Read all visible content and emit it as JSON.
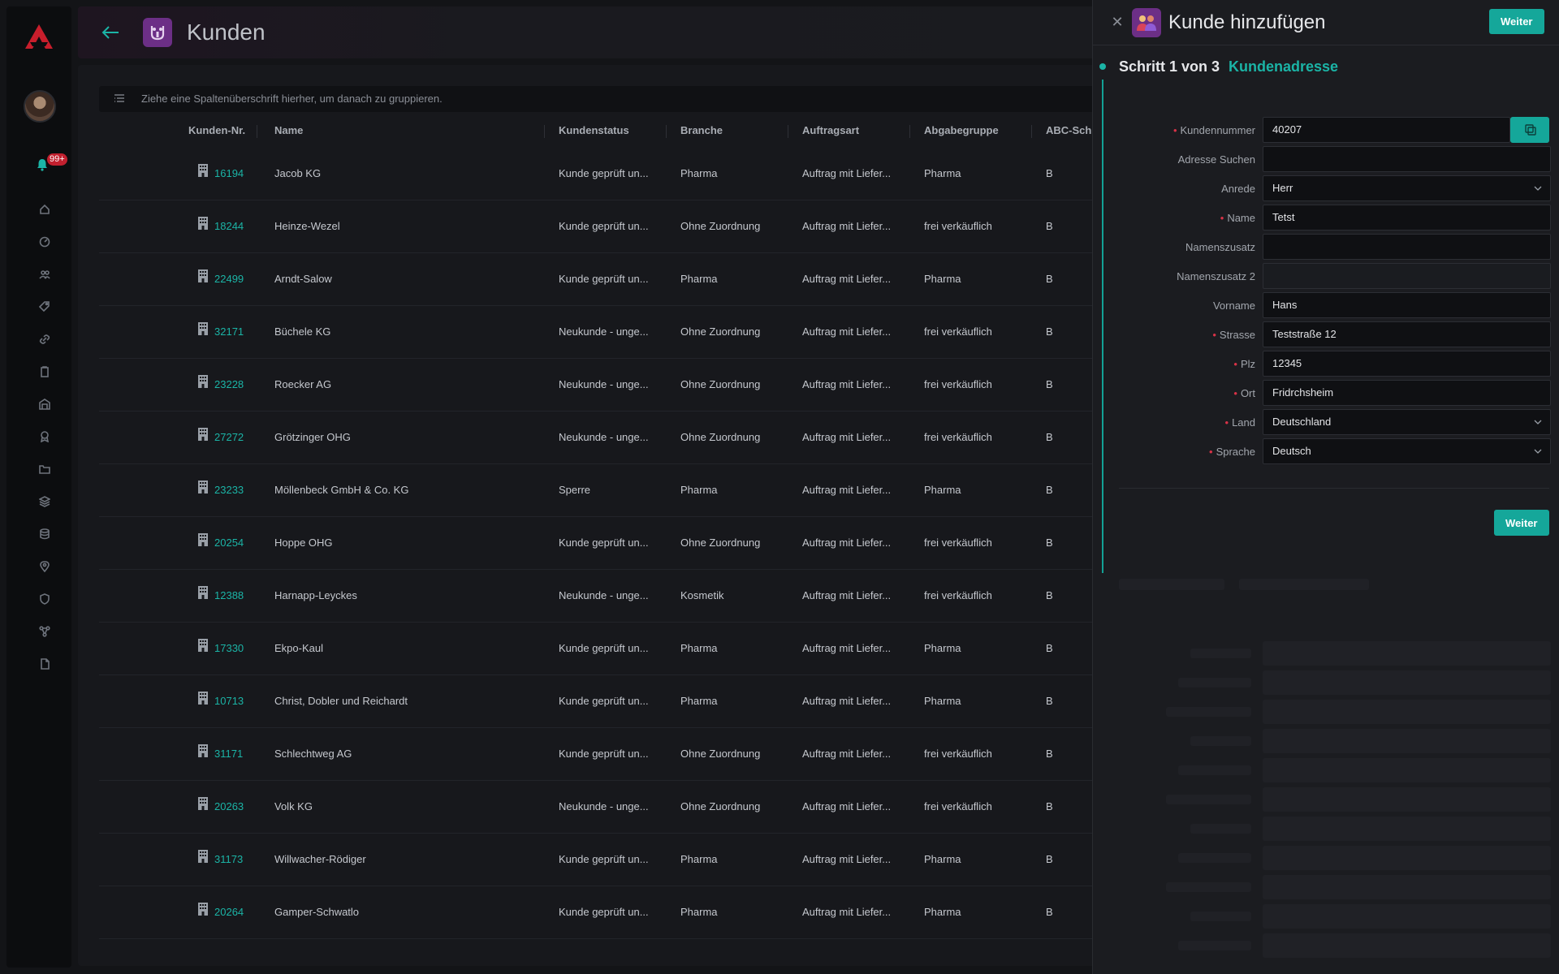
{
  "sidebar": {
    "notifications_count": "99+",
    "nav_icons": [
      "home-icon",
      "dashboard-icon",
      "users-icon",
      "tag-icon",
      "link-icon",
      "clipboard-icon",
      "warehouse-icon",
      "badge-icon",
      "folder-icon",
      "layers-icon",
      "database-icon",
      "location-icon",
      "shield-icon",
      "network-icon",
      "document-icon"
    ]
  },
  "header": {
    "title": "Kunden"
  },
  "table": {
    "group_hint": "Ziehe eine Spaltenüberschrift hierher, um danach zu gruppieren.",
    "columns": [
      "Kunden-Nr.",
      "Name",
      "Kundenstatus",
      "Branche",
      "Auftragsart",
      "Abgabegruppe",
      "ABC-Schl"
    ],
    "rows": [
      {
        "nr": "16194",
        "name": "Jacob KG",
        "status": "Kunde geprüft un...",
        "branche": "Pharma",
        "auftragsart": "Auftrag mit Liefer...",
        "abgabe": "Pharma",
        "abc": "B"
      },
      {
        "nr": "18244",
        "name": "Heinze-Wezel",
        "status": "Kunde geprüft un...",
        "branche": "Ohne Zuordnung",
        "auftragsart": "Auftrag mit Liefer...",
        "abgabe": "frei verkäuflich",
        "abc": "B"
      },
      {
        "nr": "22499",
        "name": "Arndt-Salow",
        "status": "Kunde geprüft un...",
        "branche": "Pharma",
        "auftragsart": "Auftrag mit Liefer...",
        "abgabe": "Pharma",
        "abc": "B"
      },
      {
        "nr": "32171",
        "name": "Büchele KG",
        "status": "Neukunde - unge...",
        "branche": "Ohne Zuordnung",
        "auftragsart": "Auftrag mit Liefer...",
        "abgabe": "frei verkäuflich",
        "abc": "B"
      },
      {
        "nr": "23228",
        "name": "Roecker AG",
        "status": "Neukunde - unge...",
        "branche": "Ohne Zuordnung",
        "auftragsart": "Auftrag mit Liefer...",
        "abgabe": "frei verkäuflich",
        "abc": "B"
      },
      {
        "nr": "27272",
        "name": "Grötzinger OHG",
        "status": "Neukunde - unge...",
        "branche": "Ohne Zuordnung",
        "auftragsart": "Auftrag mit Liefer...",
        "abgabe": "frei verkäuflich",
        "abc": "B"
      },
      {
        "nr": "23233",
        "name": "Möllenbeck GmbH & Co. KG",
        "status": "Sperre",
        "branche": "Pharma",
        "auftragsart": "Auftrag mit Liefer...",
        "abgabe": "Pharma",
        "abc": "B"
      },
      {
        "nr": "20254",
        "name": "Hoppe OHG",
        "status": "Kunde geprüft un...",
        "branche": "Ohne Zuordnung",
        "auftragsart": "Auftrag mit Liefer...",
        "abgabe": "frei verkäuflich",
        "abc": "B"
      },
      {
        "nr": "12388",
        "name": "Harnapp-Leyckes",
        "status": "Neukunde - unge...",
        "branche": "Kosmetik",
        "auftragsart": "Auftrag mit Liefer...",
        "abgabe": "frei verkäuflich",
        "abc": "B"
      },
      {
        "nr": "17330",
        "name": "Ekpo-Kaul",
        "status": "Kunde geprüft un...",
        "branche": "Pharma",
        "auftragsart": "Auftrag mit Liefer...",
        "abgabe": "Pharma",
        "abc": "B"
      },
      {
        "nr": "10713",
        "name": "Christ, Dobler und Reichardt",
        "status": "Kunde geprüft un...",
        "branche": "Pharma",
        "auftragsart": "Auftrag mit Liefer...",
        "abgabe": "Pharma",
        "abc": "B"
      },
      {
        "nr": "31171",
        "name": "Schlechtweg AG",
        "status": "Kunde geprüft un...",
        "branche": "Ohne Zuordnung",
        "auftragsart": "Auftrag mit Liefer...",
        "abgabe": "frei verkäuflich",
        "abc": "B"
      },
      {
        "nr": "20263",
        "name": "Volk KG",
        "status": "Neukunde - unge...",
        "branche": "Ohne Zuordnung",
        "auftragsart": "Auftrag mit Liefer...",
        "abgabe": "frei verkäuflich",
        "abc": "B"
      },
      {
        "nr": "31173",
        "name": "Willwacher-Rödiger",
        "status": "Kunde geprüft un...",
        "branche": "Pharma",
        "auftragsart": "Auftrag mit Liefer...",
        "abgabe": "Pharma",
        "abc": "B"
      },
      {
        "nr": "20264",
        "name": "Gamper-Schwatlo",
        "status": "Kunde geprüft un...",
        "branche": "Pharma",
        "auftragsart": "Auftrag mit Liefer...",
        "abgabe": "Pharma",
        "abc": "B"
      }
    ]
  },
  "drawer": {
    "title": "Kunde hinzufügen",
    "next_label": "Weiter",
    "step_title": "Schritt 1 von 3",
    "step_subtitle": "Kundenadresse",
    "fields": [
      {
        "label": "Kundennummer",
        "required": true,
        "value": "40207",
        "type": "text"
      },
      {
        "label": "Adresse Suchen",
        "required": false,
        "value": "",
        "type": "text"
      },
      {
        "label": "Anrede",
        "required": false,
        "value": "Herr",
        "type": "select"
      },
      {
        "label": "Name",
        "required": true,
        "value": "Tetst",
        "type": "text"
      },
      {
        "label": "Namenszusatz",
        "required": false,
        "value": "",
        "type": "text"
      },
      {
        "label": "Namenszusatz 2",
        "required": false,
        "value": "",
        "type": "text"
      },
      {
        "label": "Vorname",
        "required": false,
        "value": "Hans",
        "type": "text"
      },
      {
        "label": "Strasse",
        "required": true,
        "value": "Teststraße 12",
        "type": "text"
      },
      {
        "label": "Plz",
        "required": true,
        "value": "12345",
        "type": "text"
      },
      {
        "label": "Ort",
        "required": true,
        "value": "Fridrchsheim",
        "type": "text"
      },
      {
        "label": "Land",
        "required": true,
        "value": "Deutschland",
        "type": "select"
      },
      {
        "label": "Sprache",
        "required": true,
        "value": "Deutsch",
        "type": "select"
      }
    ]
  },
  "colors": {
    "accent": "#15a79a",
    "required": "#d93247",
    "app_icon": "#6c2f86"
  }
}
